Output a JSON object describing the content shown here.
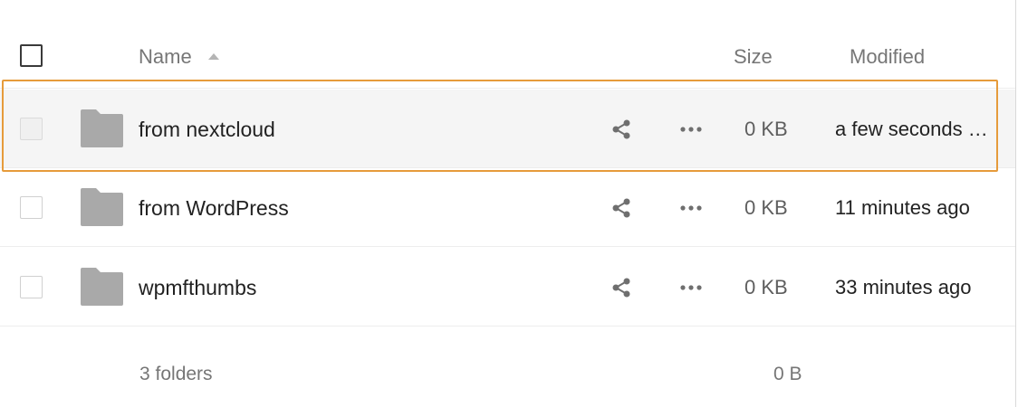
{
  "header": {
    "name_label": "Name",
    "size_label": "Size",
    "modified_label": "Modified"
  },
  "rows": [
    {
      "name": "from nextcloud",
      "size": "0 KB",
      "modified": "a few seconds ago",
      "selected": true
    },
    {
      "name": "from WordPress",
      "size": "0 KB",
      "modified": "11 minutes ago",
      "selected": false
    },
    {
      "name": "wpmfthumbs",
      "size": "0 KB",
      "modified": "33 minutes ago",
      "selected": false
    }
  ],
  "footer": {
    "count": "3 folders",
    "total_size": "0 B"
  },
  "colors": {
    "highlight": "#e69b3b",
    "folder": "#a9a9a9",
    "icon": "#6f6f6f"
  }
}
